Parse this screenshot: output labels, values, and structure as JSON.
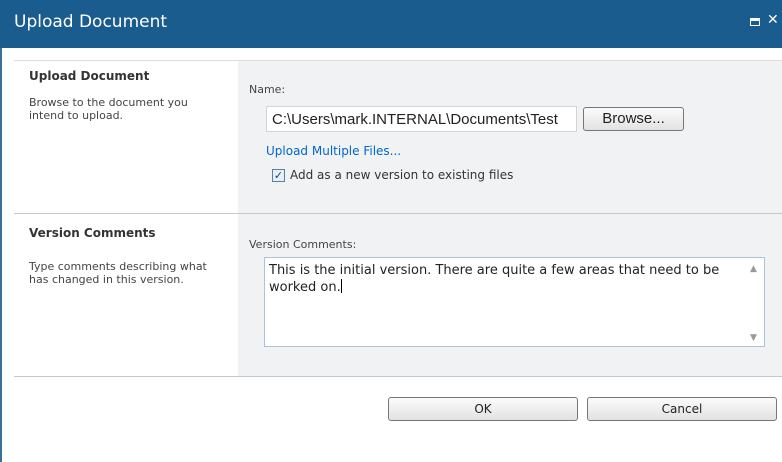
{
  "dialog": {
    "title": "Upload Document",
    "title_bar_color": "#1b5c8e"
  },
  "upload_section": {
    "heading": "Upload Document",
    "description": "Browse to the document you intend to upload.",
    "name_label": "Name:",
    "file_path_value": "C:\\Users\\mark.INTERNAL\\Documents\\Test",
    "browse_label": "Browse...",
    "upload_multiple_label": "Upload Multiple Files...",
    "add_version_checked": true,
    "add_version_label": "Add as a new version to existing files"
  },
  "version_section": {
    "heading": "Version Comments",
    "description": "Type comments describing what has changed in this version.",
    "field_label": "Version Comments:",
    "comments_value": "This is the initial version. There are quite a few areas that need to be worked on."
  },
  "footer": {
    "ok_label": "OK",
    "cancel_label": "Cancel"
  },
  "icons": {
    "maximize": "maximize-icon",
    "close": "close-icon",
    "checkbox": "checkbox-checked-icon"
  }
}
